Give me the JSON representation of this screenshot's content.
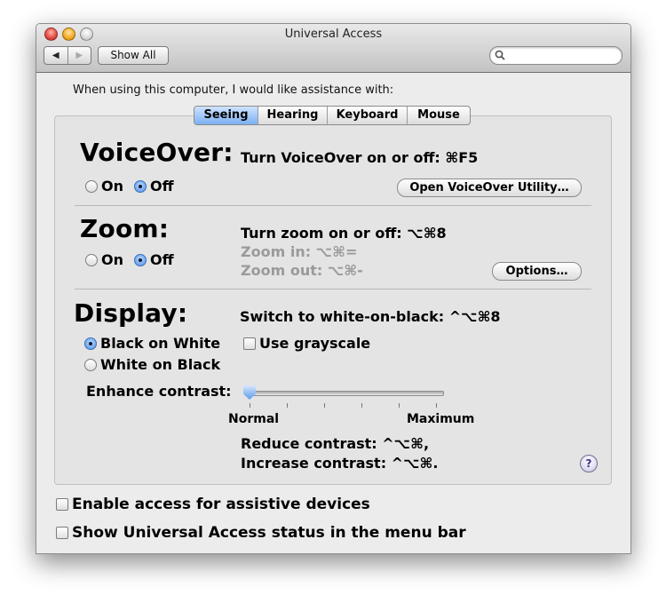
{
  "window": {
    "title": "Universal Access"
  },
  "toolbar": {
    "back_label": "◀",
    "forward_label": "▶",
    "show_all_label": "Show All",
    "search_placeholder": ""
  },
  "prompt": "When using this computer, I would like assistance with:",
  "tabs": [
    {
      "label": "Seeing",
      "active": true
    },
    {
      "label": "Hearing",
      "active": false
    },
    {
      "label": "Keyboard",
      "active": false
    },
    {
      "label": "Mouse",
      "active": false
    }
  ],
  "voiceover": {
    "heading": "VoiceOver:",
    "shortcut": "Turn VoiceOver on or off: ⌘F5",
    "on_label": "On",
    "off_label": "Off",
    "selected": "Off",
    "utility_button": "Open VoiceOver Utility…"
  },
  "zoom": {
    "heading": "Zoom:",
    "shortcut": "Turn zoom on or off: ⌥⌘8",
    "zoom_in": "Zoom in: ⌥⌘=",
    "zoom_out": "Zoom out: ⌥⌘-",
    "on_label": "On",
    "off_label": "Off",
    "selected": "Off",
    "options_button": "Options…"
  },
  "display": {
    "heading": "Display:",
    "shortcut": "Switch to white-on-black: ^⌥⌘8",
    "black_on_white": "Black on White",
    "white_on_black": "White on Black",
    "selected": "Black on White",
    "grayscale_label": "Use grayscale",
    "grayscale_checked": false,
    "contrast_label": "Enhance contrast:",
    "contrast_min": "Normal",
    "contrast_max": "Maximum",
    "contrast_value": 0,
    "reduce": "Reduce contrast: ^⌥⌘,",
    "increase": "Increase contrast: ^⌥⌘."
  },
  "help_label": "?",
  "assistive_devices": {
    "label": "Enable access for assistive devices",
    "checked": false
  },
  "status_menu": {
    "label": "Show Universal Access status in the menu bar",
    "checked": false
  },
  "colors": {
    "accent": "#4b8fe6",
    "tab_active": "#7cb0f2",
    "disabled_text": "#9a9a9a"
  }
}
